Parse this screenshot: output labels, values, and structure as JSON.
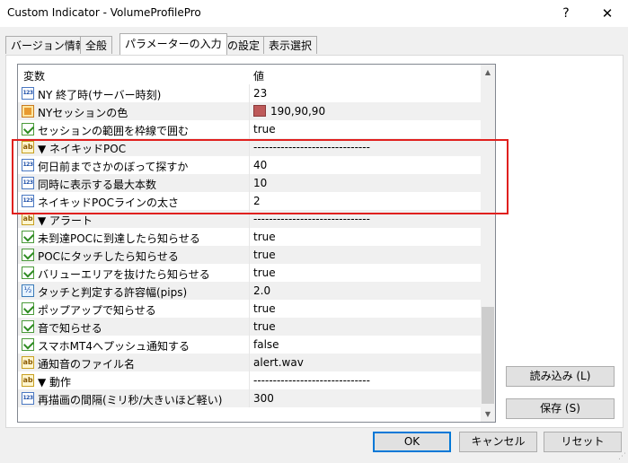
{
  "window": {
    "title": "Custom Indicator - VolumeProfilePro",
    "help": "?",
    "close": "✕"
  },
  "tabs": [
    "バージョン情報",
    "全般",
    "パラメーターの入力",
    "色の設定",
    "表示選択"
  ],
  "table": {
    "col_variable": "変数",
    "col_value": "値",
    "rows": [
      {
        "icon": "int",
        "name": "NY 終了時(サーバー時刻)",
        "value": "23"
      },
      {
        "icon": "color",
        "name": "NYセッションの色",
        "value": "190,90,90",
        "swatch": "#be5a5a"
      },
      {
        "icon": "bool",
        "name": "セッションの範囲を枠線で囲む",
        "value": "true"
      },
      {
        "icon": "str",
        "name": "▼ ネイキッドPOC",
        "value": "------------------------------"
      },
      {
        "icon": "int",
        "name": "何日前までさかのぼって探すか",
        "value": "40"
      },
      {
        "icon": "int",
        "name": "同時に表示する最大本数",
        "value": "10"
      },
      {
        "icon": "int",
        "name": "ネイキッドPOCラインの太さ",
        "value": "2"
      },
      {
        "icon": "str",
        "name": "▼ アラート",
        "value": "------------------------------"
      },
      {
        "icon": "bool",
        "name": "未到達POCに到達したら知らせる",
        "value": "true"
      },
      {
        "icon": "bool",
        "name": "POCにタッチしたら知らせる",
        "value": "true"
      },
      {
        "icon": "bool",
        "name": "バリューエリアを抜けたら知らせる",
        "value": "true"
      },
      {
        "icon": "dbl",
        "name": "タッチと判定する許容幅(pips)",
        "value": "2.0"
      },
      {
        "icon": "bool",
        "name": "ポップアップで知らせる",
        "value": "true"
      },
      {
        "icon": "bool",
        "name": "音で知らせる",
        "value": "true"
      },
      {
        "icon": "bool",
        "name": "スマホMT4へプッシュ通知する",
        "value": "false"
      },
      {
        "icon": "str",
        "name": "通知音のファイル名",
        "value": "alert.wav"
      },
      {
        "icon": "str",
        "name": "▼ 動作",
        "value": "------------------------------"
      },
      {
        "icon": "int",
        "name": "再描画の間隔(ミリ秒/大きいほど軽い)",
        "value": "300"
      }
    ]
  },
  "buttons": {
    "load": "読み込み (L)",
    "save": "保存 (S)",
    "ok": "OK",
    "cancel": "キャンセル",
    "reset": "リセット"
  },
  "highlight_color": "#e0201e"
}
